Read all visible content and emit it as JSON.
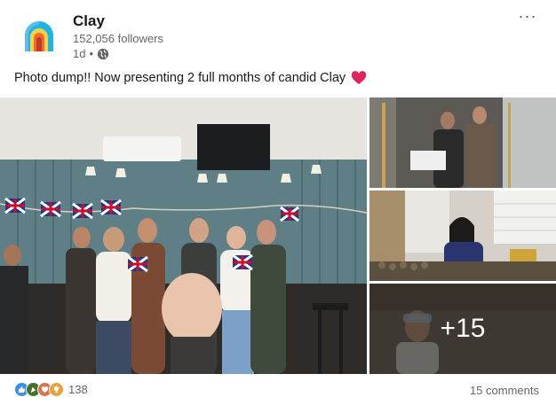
{
  "company": {
    "name": "Clay",
    "followers": "152,056 followers",
    "time": "1d",
    "separator": "•",
    "more_icon": "more-horizontal-icon",
    "visibility_icon": "globe-icon"
  },
  "post": {
    "text": "Photo dump!! Now presenting 2 full months of candid Clay",
    "emoji_icon": "red-heart-icon",
    "more_images_count": "+15"
  },
  "social": {
    "reaction_icons": [
      "like-icon",
      "celebrate-icon",
      "love-icon",
      "insightful-icon"
    ],
    "reaction_count": "138",
    "comments": "15 comments"
  },
  "colors": {
    "like": "#378fe9",
    "celebrate": "#44712e",
    "love": "#df704d",
    "insightful": "#e7a33e",
    "heart": "#e0245e",
    "text_secondary": "#666666"
  }
}
